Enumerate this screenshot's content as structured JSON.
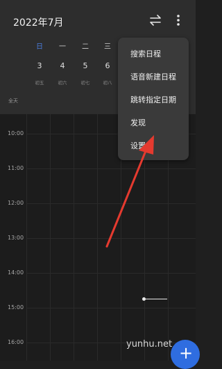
{
  "header": {
    "title": "2022年7月"
  },
  "week": {
    "weekdays": [
      "日",
      "一",
      "二",
      "三"
    ],
    "dates": [
      "3",
      "4",
      "5",
      "6"
    ],
    "lunar": [
      "初五",
      "初六",
      "初七",
      "初八"
    ]
  },
  "allday_label": "全天",
  "times": [
    "10:00",
    "11:00",
    "12:00",
    "13:00",
    "14:00",
    "15:00",
    "16:00"
  ],
  "menu": {
    "items": [
      "搜索日程",
      "语音新建日程",
      "跳转指定日期",
      "发现",
      "设置"
    ]
  },
  "watermark": "yunhu.net",
  "colors": {
    "accent": "#2f6de0",
    "today": "#4a7bd9",
    "arrow": "#e53a2f"
  }
}
